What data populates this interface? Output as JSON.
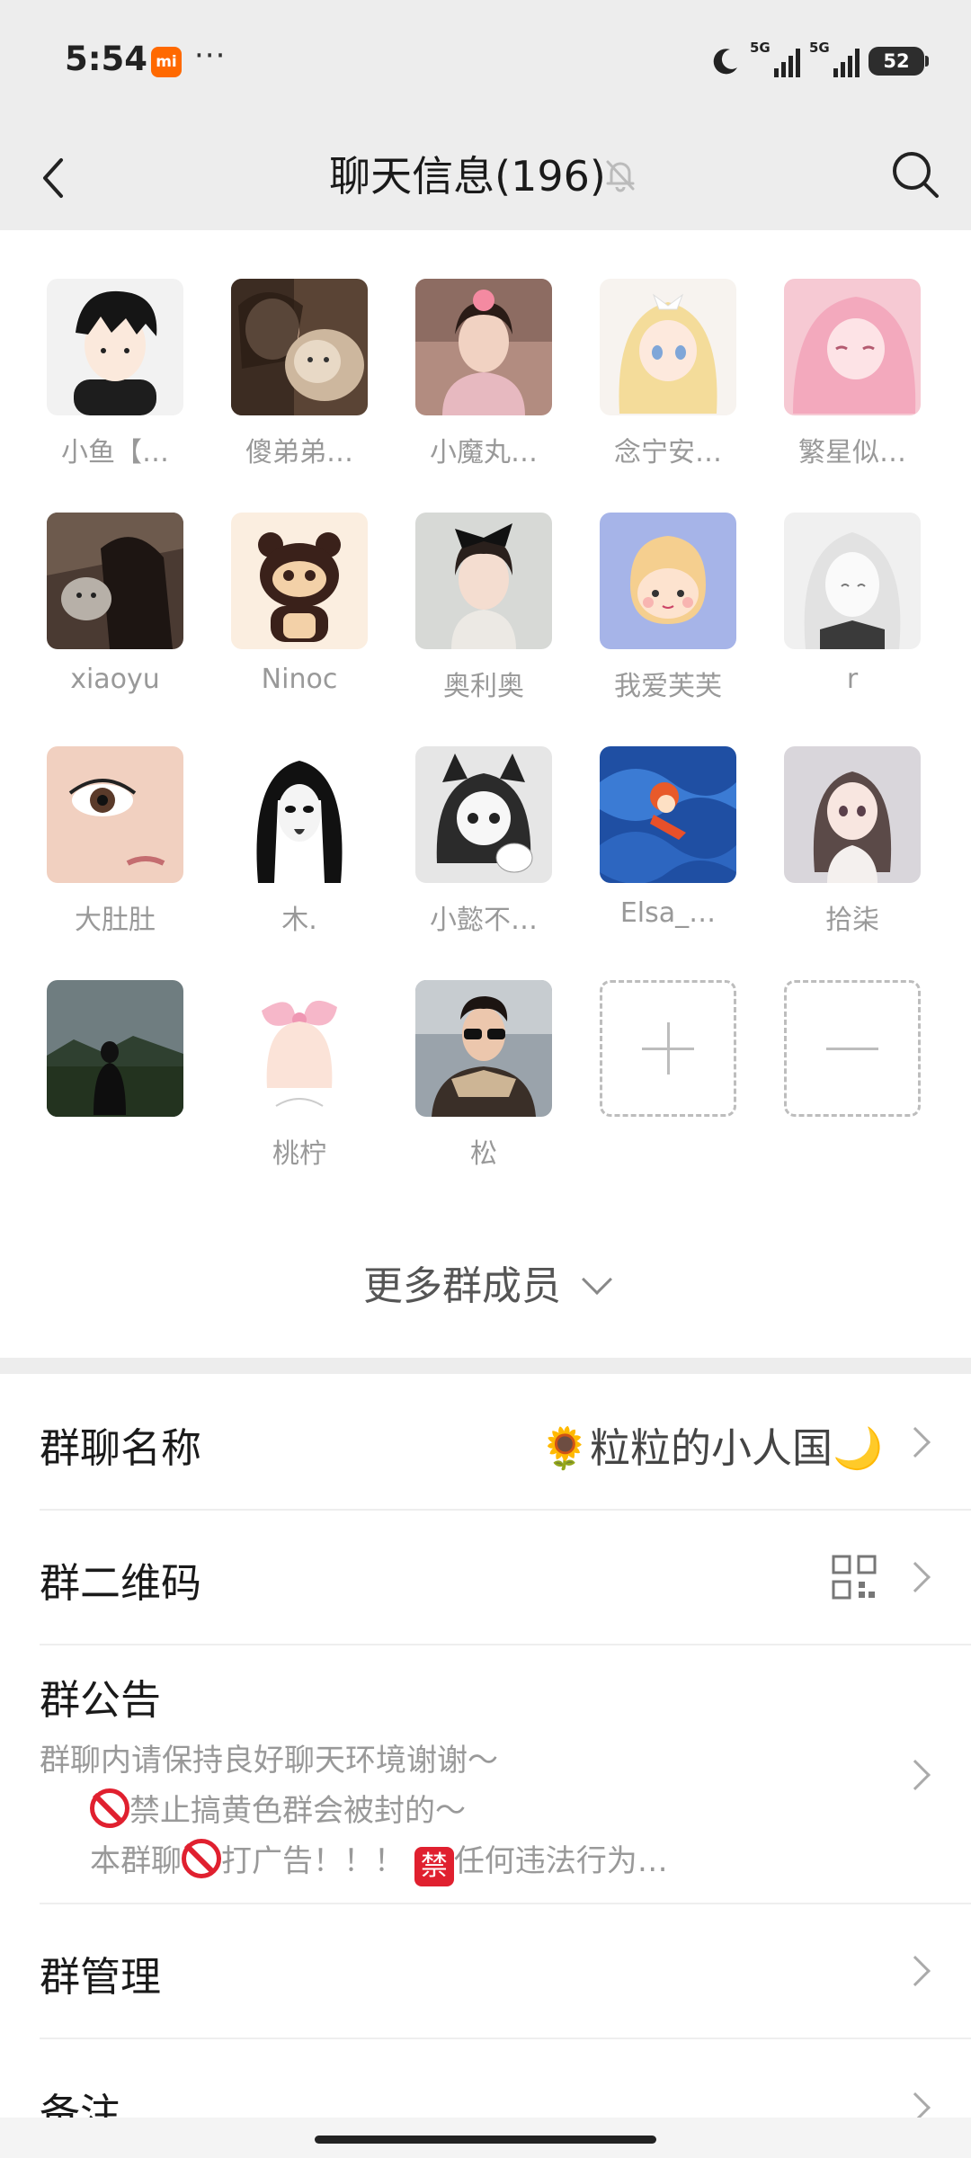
{
  "status_bar": {
    "time": "5:54",
    "mi_badge": "mi",
    "dots": "···",
    "sim1": "5G",
    "sim2": "5G",
    "battery": "52"
  },
  "nav": {
    "title": "聊天信息(196)",
    "icons": {
      "back": "back-arrow-icon",
      "mute": "bell-muted-icon",
      "search": "search-icon"
    }
  },
  "members": [
    {
      "name": "小鱼【…",
      "avatar": "anime-boy-avatar"
    },
    {
      "name": "傻弟弟…",
      "avatar": "girl-with-cat-avatar"
    },
    {
      "name": "小魔丸…",
      "avatar": "girl-photo-avatar"
    },
    {
      "name": "念宁安…",
      "avatar": "anime-blonde-girl-avatar"
    },
    {
      "name": "繁星似…",
      "avatar": "pink-anime-girl-avatar"
    },
    {
      "name": "xiaoyu",
      "avatar": "girl-with-kitten-avatar"
    },
    {
      "name": "Ninoc",
      "avatar": "cartoon-bear-avatar"
    },
    {
      "name": "奥利奥",
      "avatar": "girl-with-bow-avatar"
    },
    {
      "name": "我爱芙芙",
      "avatar": "cartoon-face-avatar"
    },
    {
      "name": "r",
      "avatar": "sketch-girl-avatar"
    },
    {
      "name": "大肚肚",
      "avatar": "eye-closeup-avatar"
    },
    {
      "name": "木.",
      "avatar": "bw-cartoon-girl-avatar"
    },
    {
      "name": "小懿不…",
      "avatar": "manga-catgirl-avatar"
    },
    {
      "name": "Elsa_…",
      "avatar": "ponyo-wave-avatar"
    },
    {
      "name": "拾柒",
      "avatar": "anime-girl-braid-avatar"
    },
    {
      "name": "",
      "avatar": "landscape-person-avatar"
    },
    {
      "name": "桃柠",
      "avatar": "pink-bow-sketch-avatar"
    },
    {
      "name": "松",
      "avatar": "boy-sunglasses-avatar"
    }
  ],
  "more_members": "更多群成员",
  "settings": {
    "group_name_label": "群聊名称",
    "group_name_value": "🌻粒粒的小人国🌙",
    "qr_label": "群二维码",
    "notice_label": "群公告",
    "notice_line1": "群聊内请保持良好聊天环境谢谢～",
    "notice_line2": "禁止搞黄色群会被封的～",
    "notice_line3_a": "本群聊",
    "notice_line3_b": "打广告！！！",
    "notice_line3_c": "任何违法行为…",
    "ban_char": "禁",
    "manage_label": "群管理",
    "remark_label": "备注"
  },
  "colors": {
    "header_bg": "#ededed",
    "accent_badge": "#ff6900",
    "muted_text": "#999999",
    "prohibit_red": "#e0202f"
  }
}
